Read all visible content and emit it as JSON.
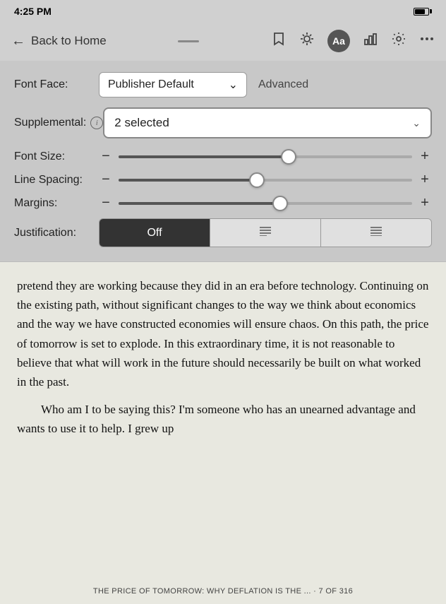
{
  "statusBar": {
    "time": "4:25 PM",
    "batteryPercent": 80
  },
  "navBar": {
    "backLabel": "Back to Home",
    "icons": {
      "bookmarks": "🔖",
      "brightness": "☀",
      "fontAa": "Aa",
      "chart": "📊",
      "settings": "⚙",
      "more": "···"
    }
  },
  "settings": {
    "fontFaceLabel": "Font Face:",
    "fontFaceValue": "Publisher Default",
    "advancedLabel": "Advanced",
    "supplementalLabel": "Supplemental:",
    "supplementalValue": "2 selected",
    "fontSizeLabel": "Font Size:",
    "lineSpacingLabel": "Line Spacing:",
    "marginsLabel": "Margins:",
    "justificationLabel": "Justification:",
    "justificationButtons": [
      "Off",
      "≡",
      "≡"
    ],
    "sliders": {
      "fontSize": 58,
      "lineSpacing": 47,
      "margins": 55
    }
  },
  "bookContent": {
    "paragraphs": [
      "pretend they are working because they did in an era before technology. Continuing on the existing path, without significant changes to the way we think about economics and the way we have constructed economies will ensure chaos. On this path, the price of tomorrow is set to explode. In this extraordinary time, it is not reasonable to believe that what will work in the future should necessarily be built on what worked in the past.",
      "Who am I to be saying this? I'm someone who has an unearned advantage and wants to use it to help. I grew up"
    ],
    "footer": "THE PRICE OF TOMORROW: WHY DEFLATION IS THE ... · 7 OF 316"
  }
}
